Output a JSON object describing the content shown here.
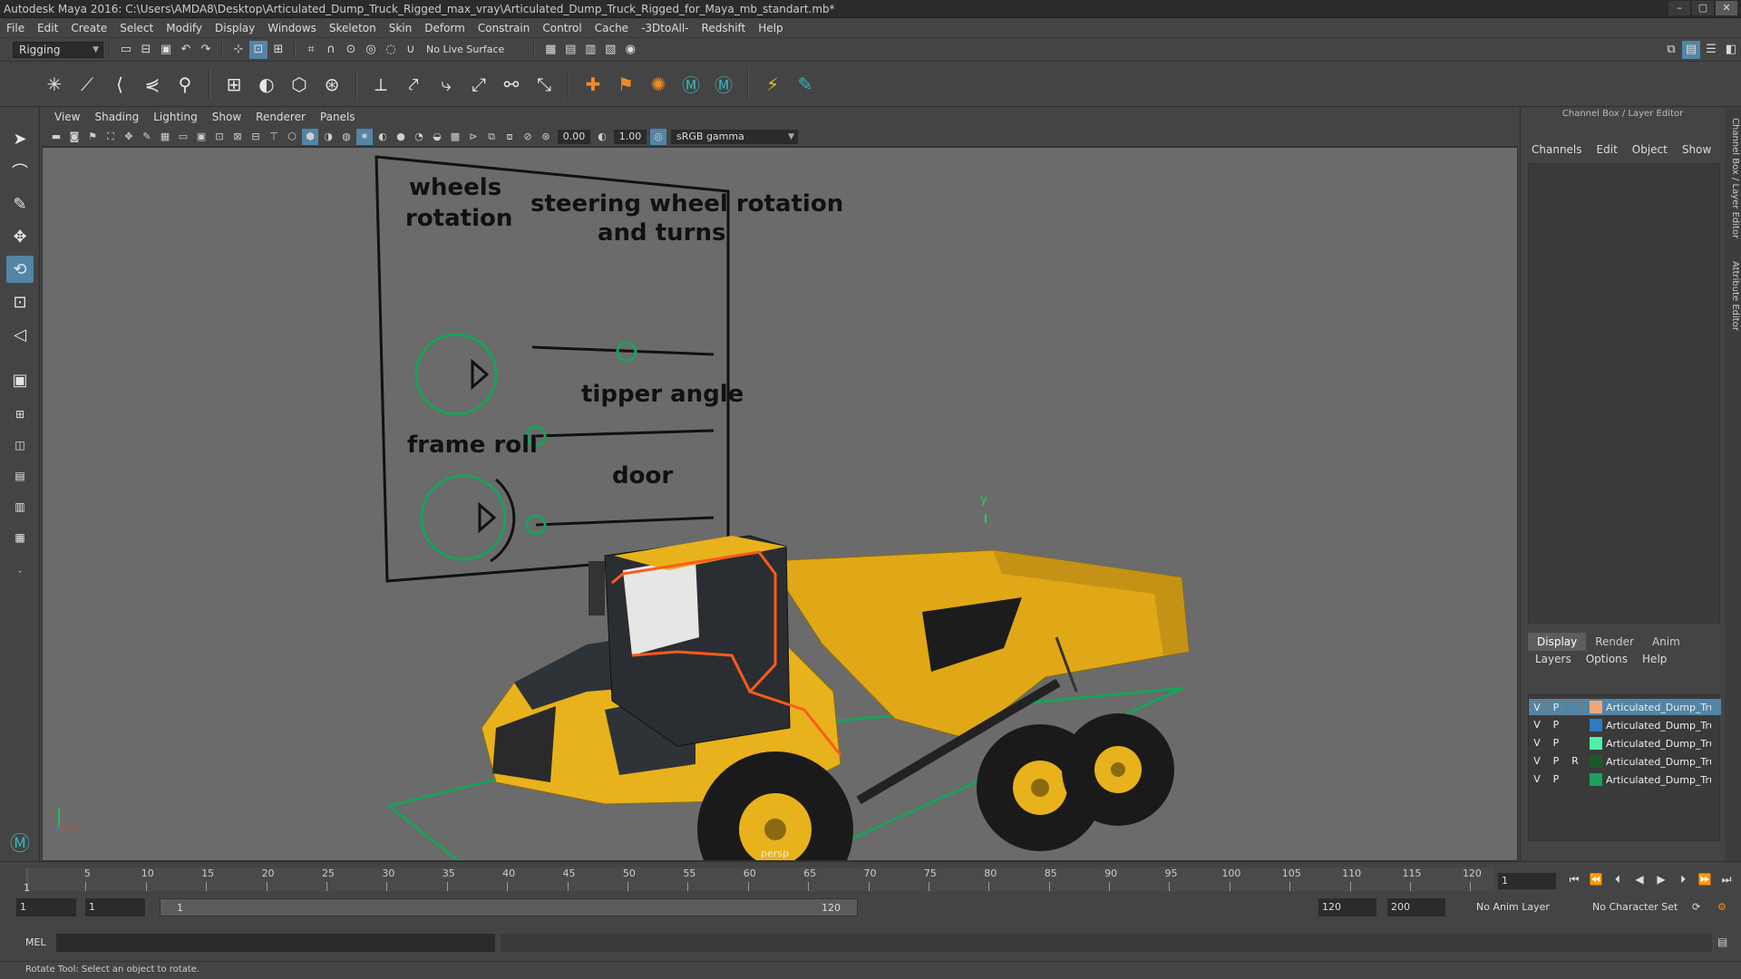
{
  "window": {
    "title": "Autodesk Maya 2016: C:\\Users\\AMDA8\\Desktop\\Articulated_Dump_Truck_Rigged_max_vray\\Articulated_Dump_Truck_Rigged_for_Maya_mb_standart.mb*"
  },
  "menu": [
    "File",
    "Edit",
    "Create",
    "Select",
    "Modify",
    "Display",
    "Windows",
    "Skeleton",
    "Skin",
    "Deform",
    "Constrain",
    "Control",
    "Cache",
    "-3DtoAll-",
    "Redshift",
    "Help"
  ],
  "statusline": {
    "mode": "Rigging",
    "live_surface": "No Live Surface"
  },
  "viewport": {
    "menu": [
      "View",
      "Shading",
      "Lighting",
      "Show",
      "Renderer",
      "Panels"
    ],
    "exposure": "0.00",
    "gamma": "1.00",
    "colorspace": "sRGB gamma",
    "camera_label": "persp",
    "axis_y": "y",
    "control_panel": {
      "wheels": "wheels rotation",
      "steering": "steering wheel rotation and turns",
      "tipper": "tipper angle",
      "frame_roll": "frame roll",
      "door": "door"
    },
    "colors": {
      "truck_body": "#e8b21c",
      "cab_dark": "#2e3338",
      "wire_orange": "#ff5a1a",
      "ground_ctrl": "#19a35a",
      "ctrl_line": "#111111"
    }
  },
  "right_panel": {
    "title": "Channel Box / Layer Editor",
    "channel_menu": [
      "Channels",
      "Edit",
      "Object",
      "Show"
    ],
    "tabs": [
      "Display",
      "Render",
      "Anim"
    ],
    "active_tab": "Display",
    "layer_menu": [
      "Layers",
      "Options",
      "Help"
    ],
    "side_tabs": [
      "Channel Box / Layer Editor",
      "Attribute Editor"
    ],
    "layers": [
      {
        "v": "V",
        "p": "P",
        "r": "",
        "color": "#f0a878",
        "name": "Articulated_Dump_Truck",
        "selected": true
      },
      {
        "v": "V",
        "p": "P",
        "r": "",
        "color": "#2f7ac2",
        "name": "Articulated_Dump_Truck",
        "selected": false
      },
      {
        "v": "V",
        "p": "P",
        "r": "",
        "color": "#4ff0a8",
        "name": "Articulated_Dump_Truck",
        "selected": false
      },
      {
        "v": "V",
        "p": "P",
        "r": "R",
        "color": "#1a5a2a",
        "name": "Articulated_Dump_Truck",
        "selected": false
      },
      {
        "v": "V",
        "p": "P",
        "r": "",
        "color": "#19a35a",
        "name": "Articulated_Dump_Truck",
        "selected": false
      }
    ]
  },
  "timeline": {
    "ticks": [
      "5",
      "10",
      "15",
      "20",
      "25",
      "30",
      "35",
      "40",
      "45",
      "50",
      "55",
      "60",
      "65",
      "70",
      "75",
      "80",
      "85",
      "90",
      "95",
      "100",
      "105",
      "110",
      "115",
      "120"
    ],
    "start_label": "1",
    "current_frame": "1"
  },
  "range": {
    "start": "1",
    "playback_start": "1",
    "slider_start": "1",
    "slider_end": "120",
    "playback_end": "120",
    "end": "200",
    "anim_layer": "No Anim Layer",
    "char_set": "No Character Set"
  },
  "cmdline": {
    "label": "MEL"
  },
  "help": {
    "text": "Rotate Tool: Select an object to rotate."
  }
}
